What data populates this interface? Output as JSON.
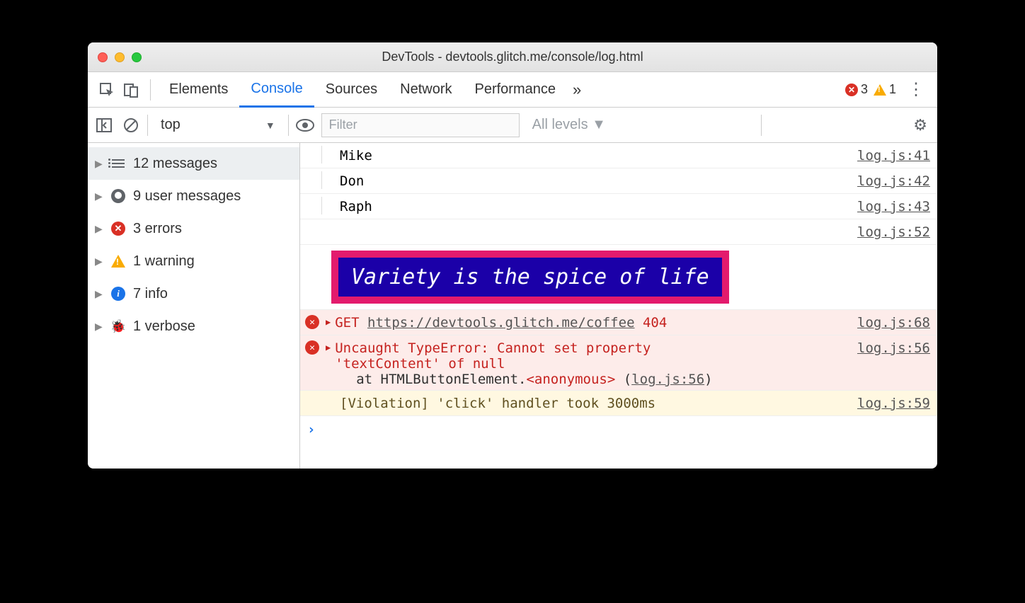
{
  "window": {
    "title": "DevTools - devtools.glitch.me/console/log.html"
  },
  "tabs": {
    "items": [
      "Elements",
      "Console",
      "Sources",
      "Network",
      "Performance"
    ],
    "activeIndex": 1,
    "more": "»",
    "errorCount": "3",
    "warningCount": "1"
  },
  "toolbar": {
    "context": "top",
    "contextChevron": "▼",
    "filterPlaceholder": "Filter",
    "levels": "All levels ▼"
  },
  "sidebar": {
    "items": [
      {
        "icon": "list",
        "label": "12 messages",
        "selected": true
      },
      {
        "icon": "user",
        "label": "9 user messages"
      },
      {
        "icon": "err",
        "label": "3 errors"
      },
      {
        "icon": "warn",
        "label": "1 warning"
      },
      {
        "icon": "info",
        "label": "7 info"
      },
      {
        "icon": "bug",
        "label": "1 verbose"
      }
    ]
  },
  "console": {
    "rows": [
      {
        "type": "plain",
        "text": "Mike",
        "src": "log.js:41",
        "indent": true
      },
      {
        "type": "plain",
        "text": "Don",
        "src": "log.js:42",
        "indent": true
      },
      {
        "type": "plain",
        "text": "Raph",
        "src": "log.js:43",
        "indent": true
      },
      {
        "type": "srcOnly",
        "src": "log.js:52"
      },
      {
        "type": "styled",
        "text": "Variety is the spice of life"
      },
      {
        "type": "error-get",
        "method": "GET",
        "url": "https://devtools.glitch.me/coffee",
        "status": "404",
        "src": "log.js:68"
      },
      {
        "type": "error-stack",
        "line1": "Uncaught TypeError: Cannot set property",
        "line2": "'textContent' of null",
        "stackPrefix": "at HTMLButtonElement.",
        "stackAnon": "<anonymous>",
        "stackOpen": " (",
        "stackLink": "log.js:56",
        "stackClose": ")",
        "src": "log.js:56"
      },
      {
        "type": "violation",
        "text": "[Violation] 'click' handler took 3000ms",
        "src": "log.js:59"
      }
    ],
    "prompt": "›"
  }
}
